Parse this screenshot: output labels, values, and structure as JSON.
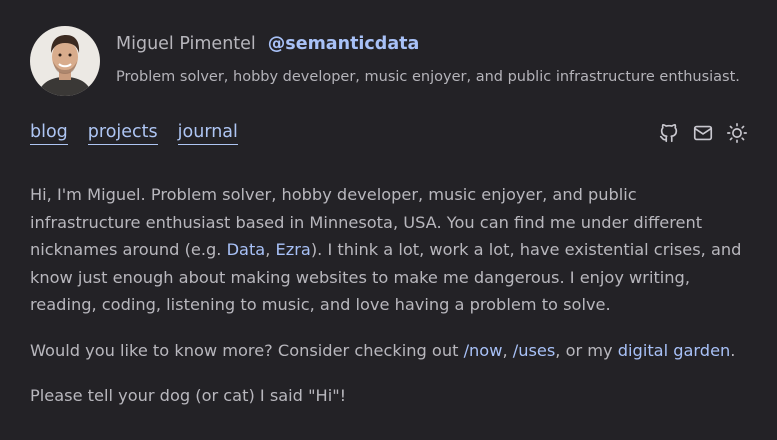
{
  "header": {
    "name": "Miguel Pimentel",
    "handle": "@semanticdata",
    "bio": "Problem solver, hobby developer, music enjoyer, and public infrastructure enthusiast."
  },
  "nav": {
    "items": [
      {
        "label": "blog"
      },
      {
        "label": "projects"
      },
      {
        "label": "journal"
      }
    ]
  },
  "icons": [
    "github-icon",
    "mail-icon",
    "sun-icon"
  ],
  "colors": {
    "background": "#232226",
    "text": "#b8b7bd",
    "link": "#a8c1f7"
  },
  "intro": {
    "part1": "Hi, I'm Miguel. Problem solver, hobby developer, music enjoyer, and public infrastructure enthusiast based in Minnesota, USA. You can find me under different nicknames around (e.g. ",
    "link_data": "Data",
    "sep": ", ",
    "link_ezra": "Ezra",
    "part2": "). I think a lot, work a lot, have existential crises, and know just enough about making websites to make me dangerous. I enjoy writing, reading, coding, listening to music, and love having a problem to solve."
  },
  "more": {
    "prefix": "Would you like to know more? Consider checking out ",
    "link_now": "/now",
    "sep1": ", ",
    "link_uses": "/uses",
    "sep2": ", or my ",
    "link_garden": "digital garden",
    "suffix": "."
  },
  "closing": "Please tell your dog (or cat) I said \"Hi\"!"
}
